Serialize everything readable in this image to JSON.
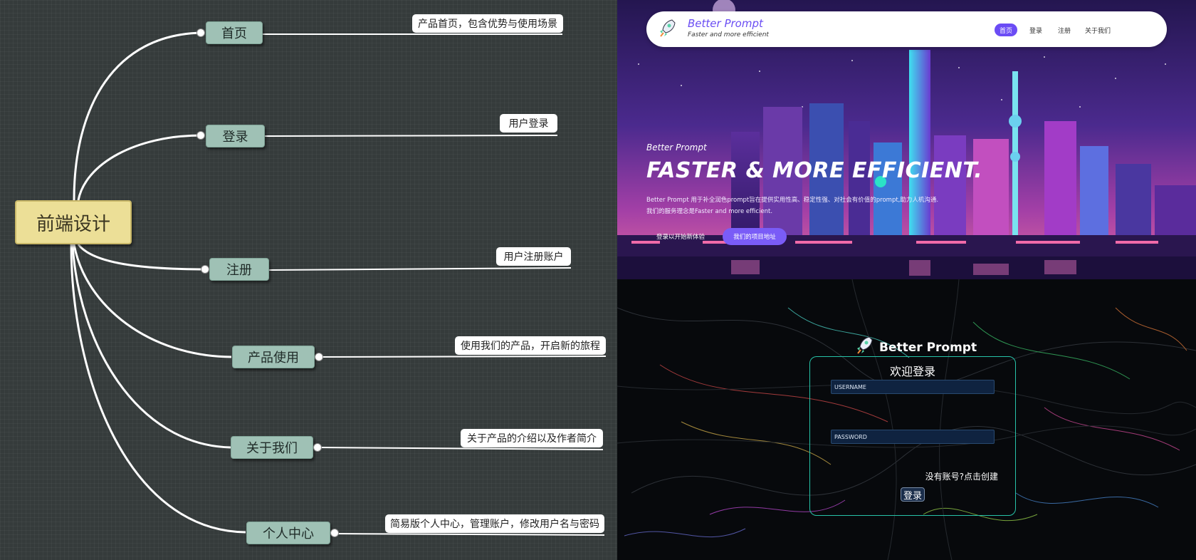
{
  "mindmap": {
    "root": "前端设计",
    "branches": [
      {
        "label": "首页",
        "note": "产品首页，包含优势与使用场景"
      },
      {
        "label": "登录",
        "note": "用户登录"
      },
      {
        "label": "注册",
        "note": "用户注册账户"
      },
      {
        "label": "产品使用",
        "note": "使用我们的产品，开启新的旅程"
      },
      {
        "label": "关于我们",
        "note": "关于产品的介绍以及作者简介"
      },
      {
        "label": "个人中心",
        "note": "简易版个人中心，管理账户，修改用户名与密码"
      }
    ],
    "colors": {
      "root": "#ecdf97",
      "node": "#9fc1b5",
      "note": "#ffffff",
      "line": "#ffffff",
      "background": "#353b3b"
    }
  },
  "landing": {
    "brand": {
      "title": "Better Prompt",
      "subtitle": "Faster and more efficient",
      "icon": "rocket-icon"
    },
    "nav": [
      "首页",
      "登录",
      "注册",
      "关于我们"
    ],
    "active_nav": "首页",
    "hero": {
      "kicker": "Better Prompt",
      "title": "FASTER & MORE EFFICIENT.",
      "desc1": "Better Prompt 用于补全润色prompt旨在提供实用性高、稳定性强、对社会有价值的prompt,助力人机沟通.",
      "desc2": "我们的服务理念是Faster and more efficient.",
      "btn_primary": "登录以开始新体验",
      "btn_secondary": "我们的项目地址"
    },
    "accent": "#6b4cf5"
  },
  "login": {
    "brand": "Better Prompt",
    "icon": "rocket-icon",
    "title": "欢迎登录",
    "username_placeholder": "USERNAME",
    "password_placeholder": "PASSWORD",
    "register_link": "没有账号?点击创建",
    "submit": "登录",
    "border_color": "#27c3a8"
  }
}
